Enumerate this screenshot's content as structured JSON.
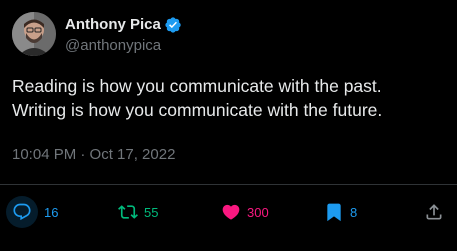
{
  "user": {
    "display_name": "Anthony Pica",
    "handle": "@anthonypica",
    "verified": true
  },
  "tweet": {
    "lines": [
      "Reading is how you communicate with the past.",
      "Writing is how you communicate with the future."
    ],
    "timestamp": "10:04 PM · Oct 17, 2022"
  },
  "actions": {
    "reply_count": "16",
    "retweet_count": "55",
    "like_count": "300",
    "bookmark_count": "8"
  },
  "colors": {
    "background": "#000000",
    "text": "#e7e9ea",
    "muted": "#71767b",
    "accent_blue": "#1d9bf0",
    "retweet_green": "#00ba7c",
    "like_pink": "#f91880"
  },
  "icons": {
    "verified": "verified-badge-icon",
    "reply": "reply-icon",
    "retweet": "retweet-icon",
    "like": "heart-icon",
    "bookmark": "bookmark-icon",
    "share": "share-icon"
  }
}
